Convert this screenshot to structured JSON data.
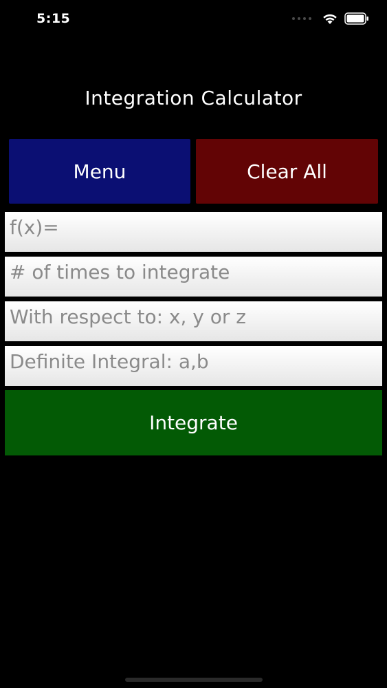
{
  "status_bar": {
    "time": "5:15"
  },
  "title": "Integration Calculator",
  "buttons": {
    "menu": "Menu",
    "clear_all": "Clear All",
    "integrate": "Integrate"
  },
  "fields": {
    "fx_placeholder": "f(x)=",
    "times_placeholder": "# of times to integrate",
    "respect_placeholder": "With respect to: x, y or z",
    "definite_placeholder": "Definite Integral: a,b"
  },
  "colors": {
    "menu": "#0b0f73",
    "clear_all": "#620405",
    "integrate": "#035a05",
    "background": "#000000"
  }
}
